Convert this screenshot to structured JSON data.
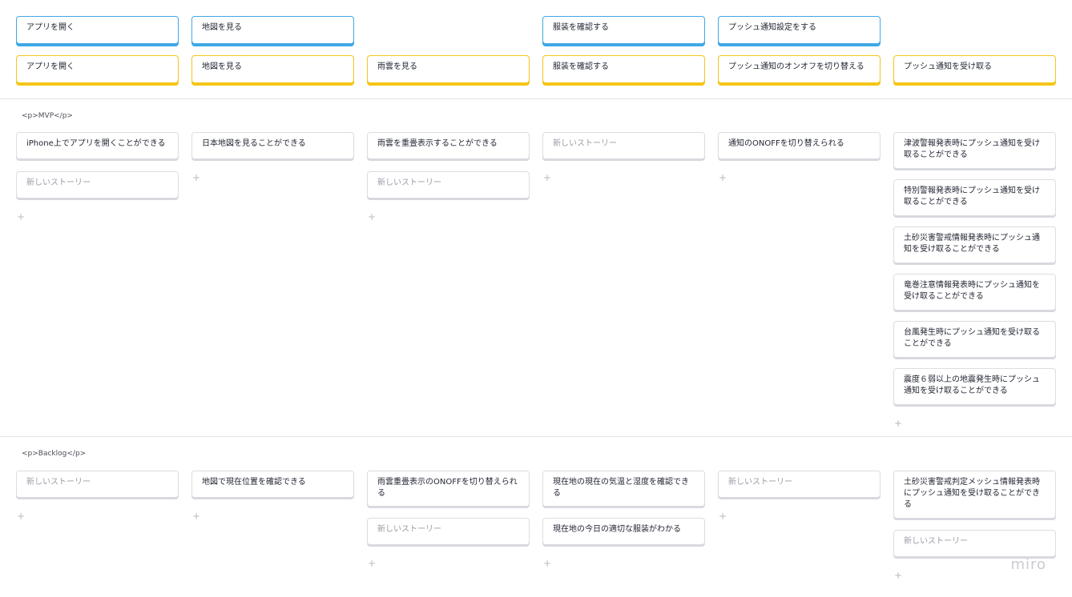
{
  "activities": [
    "アプリを開く",
    "地図を見る",
    "服装を確認する",
    "プッシュ通知設定をする"
  ],
  "steps": [
    "アプリを開く",
    "地図を見る",
    "雨雲を見る",
    "服装を確認する",
    "プッシュ通知のオンオフを切り替える",
    "プッシュ通知を受け取る"
  ],
  "releases": [
    {
      "label": "<p>MVP</p>",
      "columns": [
        [
          "iPhone上でアプリを開くことができる",
          "新しいストーリー"
        ],
        [
          "日本地図を見ることができる"
        ],
        [
          "雨雲を重畳表示することができる",
          "新しいストーリー"
        ],
        [
          "新しいストーリー"
        ],
        [
          "通知のONOFFを切り替えられる"
        ],
        [
          "津波警報発表時にプッシュ通知を受け取ることができる",
          "特別警報発表時にプッシュ通知を受け取ることができる",
          "土砂災害警戒情報発表時にプッシュ通知を受け取ることができる",
          "竜巻注意情報発表時にプッシュ通知を受け取ることができる",
          "台風発生時にプッシュ通知を受け取ることができる",
          "震度６弱以上の地震発生時にプッシュ通知を受け取ることができる"
        ]
      ]
    },
    {
      "label": "<p>Backlog</p>",
      "columns": [
        [
          "新しいストーリー"
        ],
        [
          "地図で現在位置を確認できる"
        ],
        [
          "雨雲重畳表示のONOFFを切り替えられる",
          "新しいストーリー"
        ],
        [
          "現在地の現在の気温と湿度を確認できる",
          "現在地の今日の適切な服装がわかる"
        ],
        [
          "新しいストーリー"
        ],
        [
          "土砂災害警戒判定メッシュ情報発表時にプッシュ通知を受け取ることができる",
          "新しいストーリー"
        ]
      ]
    }
  ],
  "add_symbol": "+",
  "logo": "miro"
}
